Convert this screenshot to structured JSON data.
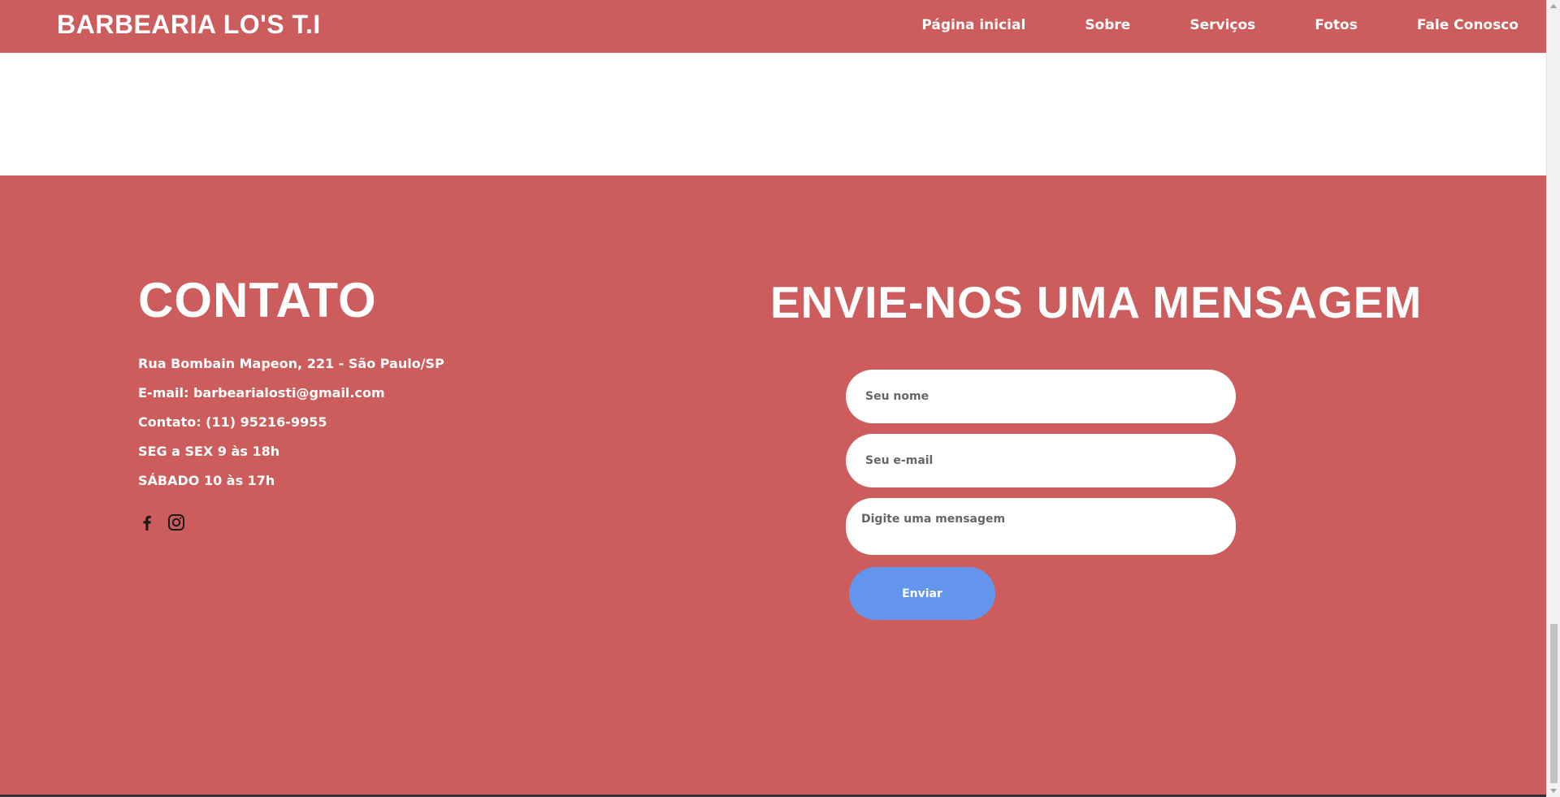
{
  "header": {
    "brand": "BARBEARIA LO'S T.I",
    "nav": [
      "Página inicial",
      "Sobre",
      "Serviços",
      "Fotos",
      "Fale Conosco"
    ]
  },
  "contact": {
    "title": "CONTATO",
    "address": "Rua Bombain Mapeon, 221 - São Paulo/SP",
    "email": "E-mail: barbearialosti@gmail.com",
    "phone": "Contato: (11) 95216-9955",
    "hours_weekday": "SEG a SEX 9 às 18h",
    "hours_saturday": "SÁBADO 10 às 17h",
    "social_icons": [
      "facebook-icon",
      "instagram-icon"
    ]
  },
  "form": {
    "title": "ENVIE-NOS UMA MENSAGEM",
    "name_placeholder": "Seu nome",
    "email_placeholder": "Seu e-mail",
    "message_placeholder": "Digite uma mensagem",
    "submit_label": "Enviar"
  },
  "colors": {
    "brand": "#cd5c5c",
    "button": "#6495ed",
    "text": "#ffffff"
  }
}
